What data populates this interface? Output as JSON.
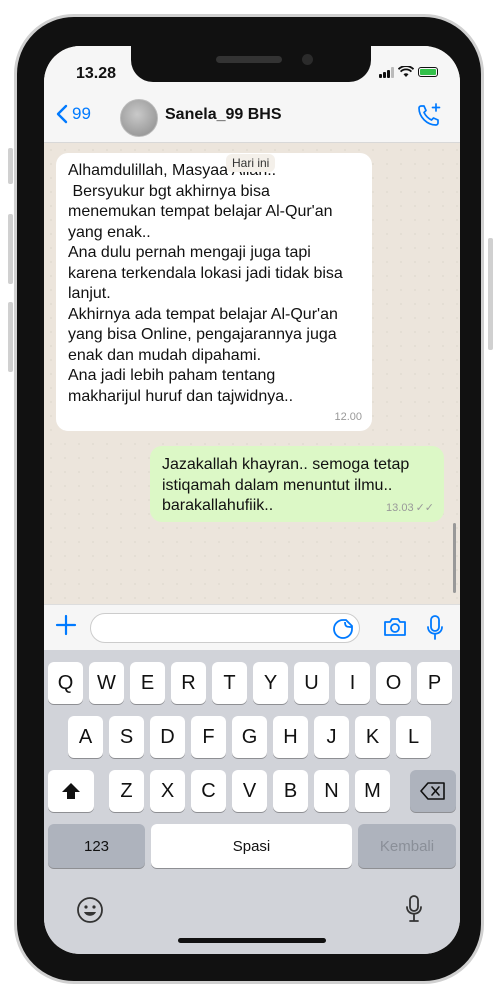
{
  "status_bar": {
    "time": "13.28"
  },
  "header": {
    "back_count": "99",
    "contact_name": "Sanela_99 BHS"
  },
  "chat": {
    "date_label": "Hari ini",
    "incoming": {
      "text": "Alhamdulillah, Masyaa Allah..\n Bersyukur bgt akhirnya bisa\nmenemukan tempat belajar Al-Qur'an\nyang enak..\nAna dulu pernah mengaji juga tapi\nkarena terkendala lokasi jadi tidak bisa\nlanjut.\nAkhirnya ada tempat belajar Al-Qur'an\nyang bisa Online, pengajarannya juga\nenak dan mudah dipahami.\nAna jadi lebih paham tentang\nmakharijul huruf dan tajwidnya..",
      "time": "12.00"
    },
    "outgoing": {
      "text": "Jazakallah khayran.. semoga tetap\nistiqamah dalam menuntut ilmu..\nbarakallahufiik..",
      "time": "13.03",
      "ticks": "✓✓"
    }
  },
  "input": {
    "placeholder": ""
  },
  "keyboard": {
    "row1": [
      "Q",
      "W",
      "E",
      "R",
      "T",
      "Y",
      "U",
      "I",
      "O",
      "P"
    ],
    "row2": [
      "A",
      "S",
      "D",
      "F",
      "G",
      "H",
      "J",
      "K",
      "L"
    ],
    "row3": [
      "Z",
      "X",
      "C",
      "V",
      "B",
      "N",
      "M"
    ],
    "numbers_label": "123",
    "space_label": "Spasi",
    "return_label": "Kembali"
  },
  "icons": {
    "back": "chevron-left-icon",
    "call": "phone-add-icon",
    "plus": "plus-icon",
    "sticker": "sticker-icon",
    "camera": "camera-icon",
    "mic": "microphone-icon",
    "shift": "shift-icon",
    "delete": "delete-icon",
    "emoji": "emoji-icon",
    "dictation": "microphone-icon"
  },
  "colors": {
    "accent": "#007aff",
    "outgoing_bubble": "#dcf8c6",
    "incoming_bubble": "#ffffff",
    "battery": "#33c14a"
  }
}
